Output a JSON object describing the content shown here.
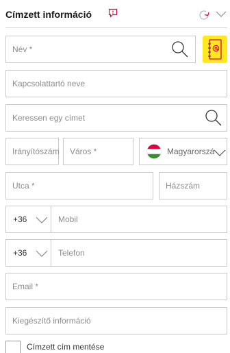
{
  "header": {
    "title": "Címzett információ"
  },
  "fields": {
    "name": {
      "placeholder": "Név *"
    },
    "contact_name": {
      "placeholder": "Kapcsolattartó neve"
    },
    "address_search": {
      "placeholder": "Keressen egy címet"
    },
    "postal_code": {
      "placeholder": "Irányítószám *"
    },
    "city": {
      "placeholder": "Város *"
    },
    "country": {
      "value": "Magyarország"
    },
    "street": {
      "placeholder": "Utca *"
    },
    "house_number": {
      "placeholder": "Házszám"
    },
    "mobile": {
      "prefix": "+36",
      "placeholder": "Mobil"
    },
    "phone": {
      "prefix": "+36",
      "placeholder": "Telefon"
    },
    "email": {
      "placeholder": "Email *"
    },
    "extra_info": {
      "placeholder": "Kiegészítő információ"
    }
  },
  "save_address": {
    "label": "Címzett cím mentése",
    "checked": false
  },
  "colors": {
    "accent_red": "#e2003c",
    "highlight_yellow": "#ffe81f",
    "border": "#c8c8c8"
  },
  "icons": [
    "comment-icon",
    "refresh-icon",
    "chevron-down-icon",
    "search-icon",
    "address-book-icon",
    "hungary-flag-icon"
  ]
}
